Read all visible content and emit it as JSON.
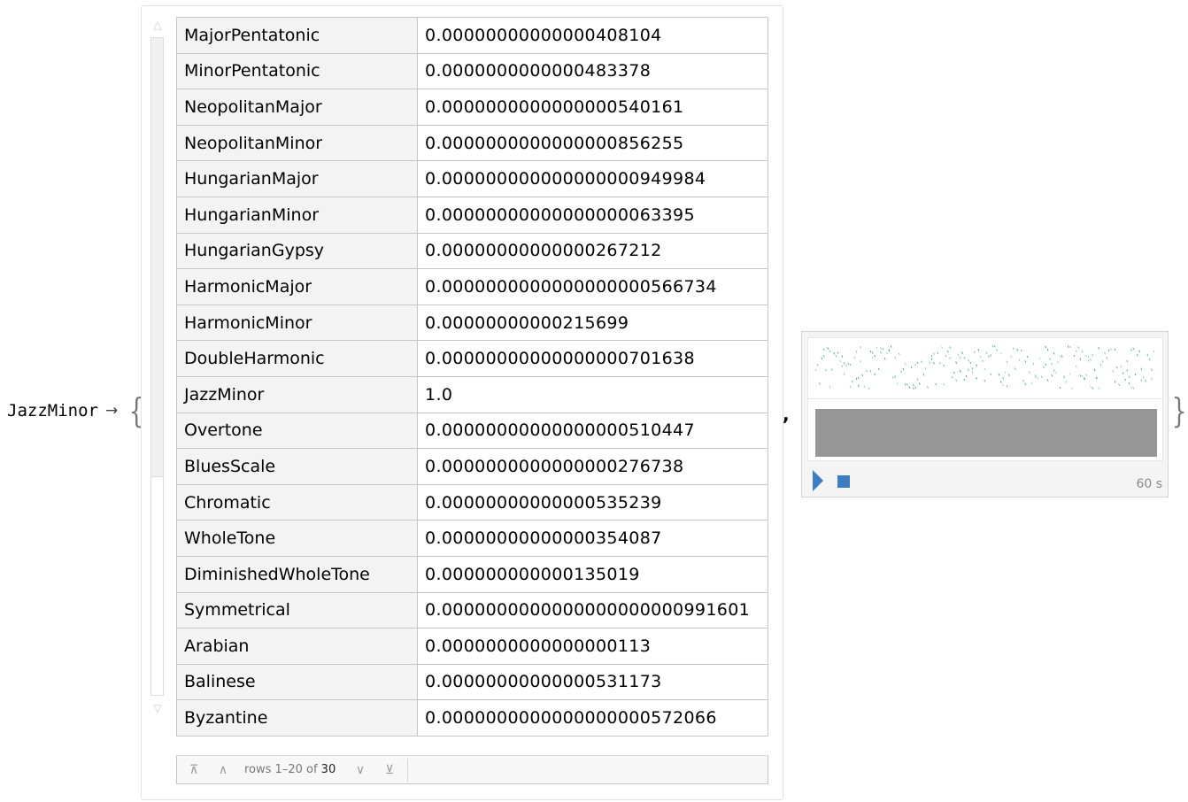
{
  "lhs": {
    "label": "JazzMinor",
    "arrow": "→",
    "open_brace": "{",
    "close_brace": "}",
    "comma": ","
  },
  "scrollbar": {
    "up": "△",
    "down": "▽",
    "visible_fraction": 0.667
  },
  "table": {
    "rows": [
      {
        "name": "MajorPentatonic",
        "value": "0.00000000000000408104"
      },
      {
        "name": "MinorPentatonic",
        "value": "0.0000000000000483378"
      },
      {
        "name": "NeopolitanMajor",
        "value": "0.0000000000000000540161"
      },
      {
        "name": "NeopolitanMinor",
        "value": "0.0000000000000000856255"
      },
      {
        "name": "HungarianMajor",
        "value": "0.000000000000000000949984"
      },
      {
        "name": "HungarianMinor",
        "value": "0.00000000000000000063395"
      },
      {
        "name": "HungarianGypsy",
        "value": "0.00000000000000267212"
      },
      {
        "name": "HarmonicMajor",
        "value": "0.0000000000000000000566734"
      },
      {
        "name": "HarmonicMinor",
        "value": "0.00000000000215699"
      },
      {
        "name": "DoubleHarmonic",
        "value": "0.00000000000000000701638"
      },
      {
        "name": "JazzMinor",
        "value": "1.0"
      },
      {
        "name": "Overtone",
        "value": "0.00000000000000000510447"
      },
      {
        "name": "BluesScale",
        "value": "0.0000000000000000276738"
      },
      {
        "name": "Chromatic",
        "value": "0.00000000000000535239"
      },
      {
        "name": "WholeTone",
        "value": "0.00000000000000354087"
      },
      {
        "name": "DiminishedWholeTone",
        "value": "0.000000000000135019"
      },
      {
        "name": "Symmetrical",
        "value": "0.0000000000000000000000991601"
      },
      {
        "name": "Arabian",
        "value": "0.0000000000000000113"
      },
      {
        "name": "Balinese",
        "value": "0.00000000000000531173"
      },
      {
        "name": "Byzantine",
        "value": "0.0000000000000000000572066"
      }
    ]
  },
  "pager": {
    "first": "⊼",
    "prev": "∧",
    "next": "∨",
    "last": "⊻",
    "rows_text": "rows 1–20 of ",
    "total": "30"
  },
  "sound": {
    "duration": "60 s",
    "note_color": "#2a9d6e",
    "wave_color": "#969696",
    "accent": "#3d7dc4"
  }
}
